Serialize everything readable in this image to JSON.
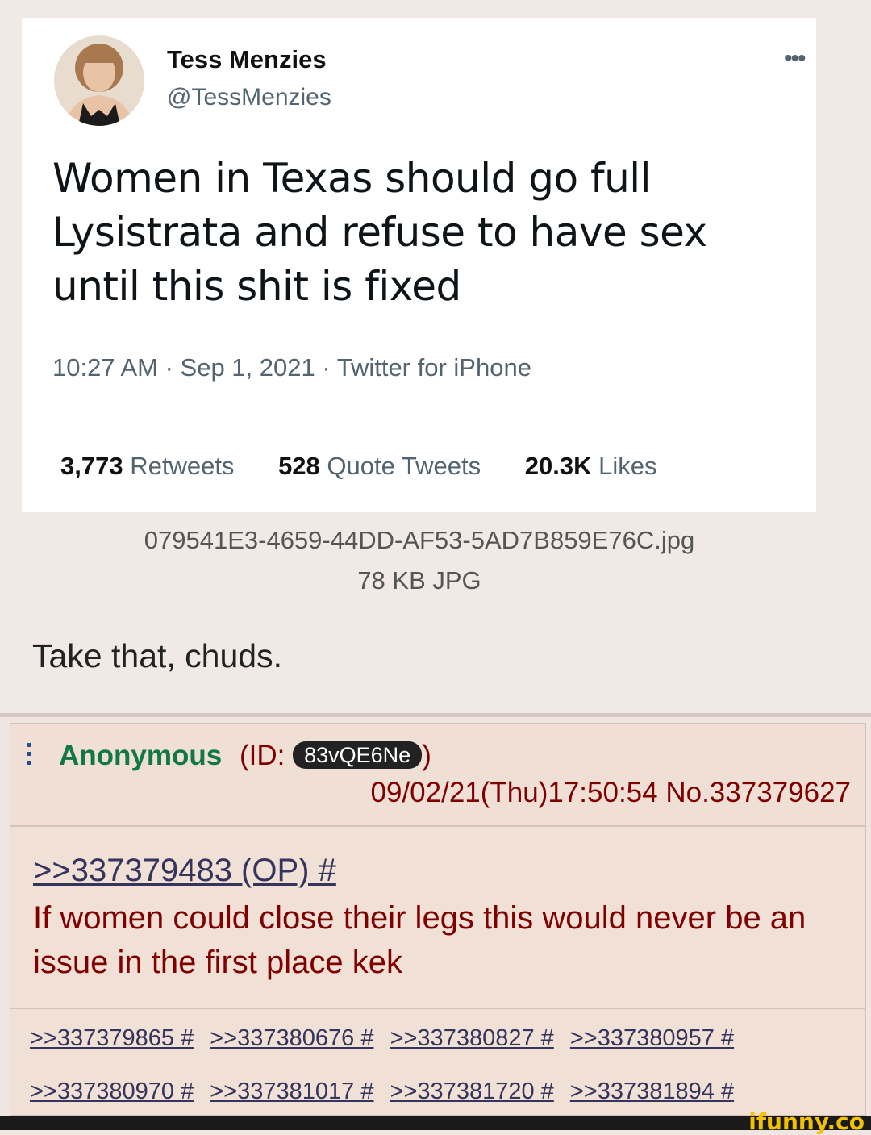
{
  "tweet": {
    "display_name": "Tess Menzies",
    "handle": "@TessMenzies",
    "more_icon": "more-dots-icon",
    "text": "Women in Texas should go full Lysistrata and refuse to have sex until this shit is fixed",
    "meta": "10:27 AM · Sep 1, 2021 · Twitter for iPhone",
    "stats": [
      {
        "count": "3,773",
        "label": "Retweets"
      },
      {
        "count": "528",
        "label": "Quote Tweets"
      },
      {
        "count": "20.3K",
        "label": "Likes"
      }
    ]
  },
  "op_file": {
    "name": "079541E3-4659-44DD-AF53-5AD7B859E76C.jpg",
    "size": "78 KB JPG"
  },
  "op_comment": "Take that, chuds.",
  "reply": {
    "name": "Anonymous",
    "id_prefix": "(ID: ",
    "id": "83vQE6Ne",
    "id_suffix": ")",
    "datetime_no": "09/02/21(Thu)17:50:54 No.337379627",
    "quote": ">>337379483 (OP) #",
    "text": "If women could close their legs this would never be an issue in the first place kek",
    "backlinks_row1": [
      ">>337379865 #",
      ">>337380676 #",
      ">>337380827 #",
      ">>337380957 #"
    ],
    "backlinks_row2": [
      ">>337380970 #",
      ">>337381017 #",
      ">>337381720 #",
      ">>337381894 #"
    ]
  },
  "watermark": "ifunny.co"
}
